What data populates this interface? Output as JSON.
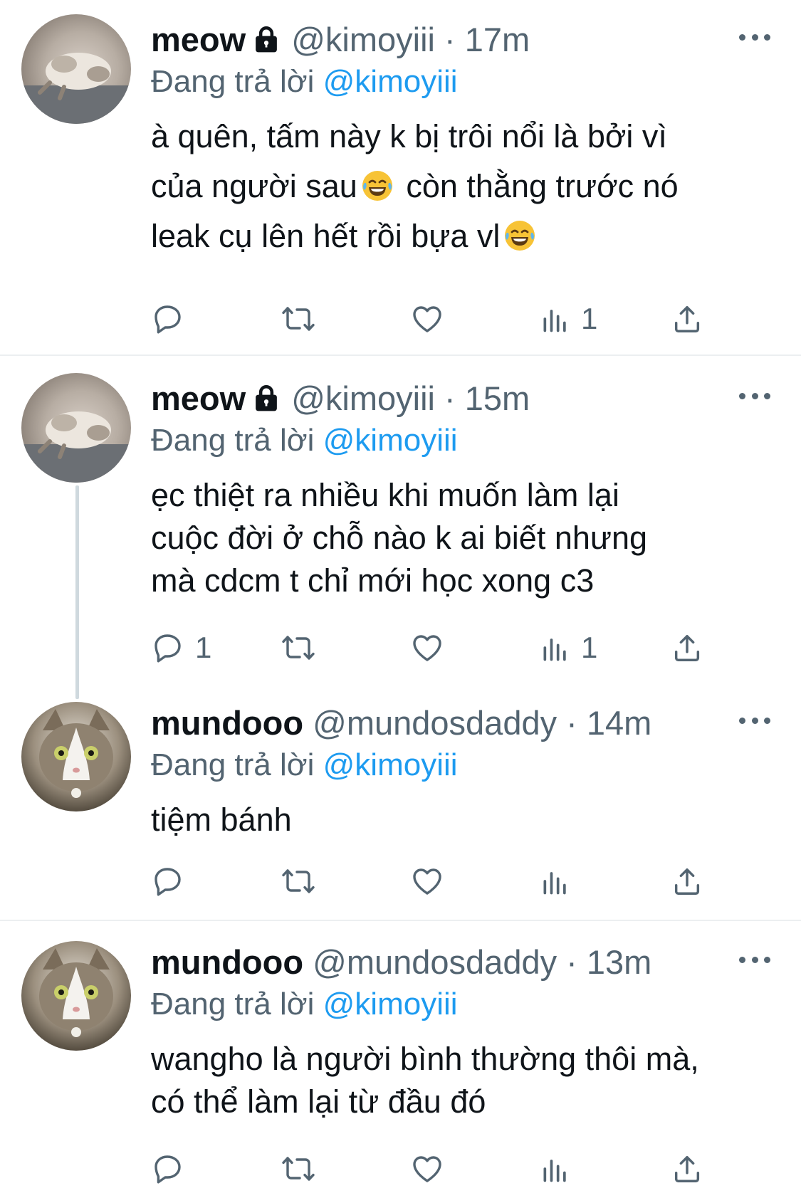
{
  "tweets": [
    {
      "name": "meow",
      "handle": "@kimoyiii",
      "separator": "·",
      "time": "17m",
      "replying_prefix": "Đang trả lời",
      "replying_to": "@kimoyiii",
      "lines": [
        "à quên, tấm này k bị trôi nổi là bởi vì",
        "của người sau",
        "còn thằng trước nó",
        "leak cụ lên hết rồi bựa vl"
      ],
      "avatar_icon": "sleeping-cat-avatar",
      "reply_count": "",
      "views_count": "1",
      "locked": true
    },
    {
      "name": "meow",
      "handle": "@kimoyiii",
      "separator": "·",
      "time": "15m",
      "replying_prefix": "Đang trả lời",
      "replying_to": "@kimoyiii",
      "lines": [
        "ẹc thiệt ra nhiều khi muốn làm lại",
        "cuộc đời ở chỗ nào k ai biết nhưng",
        "mà cdcm t chỉ mới học xong c3"
      ],
      "avatar_icon": "sleeping-cat-avatar",
      "reply_count": "1",
      "views_count": "1",
      "locked": true
    },
    {
      "name": "mundooo",
      "handle": "@mundosdaddy",
      "separator": "·",
      "time": "14m",
      "replying_prefix": "Đang trả lời",
      "replying_to": "@kimoyiii",
      "lines": [
        "tiệm bánh"
      ],
      "avatar_icon": "cat-face-avatar",
      "reply_count": "",
      "views_count": "",
      "locked": false
    },
    {
      "name": "mundooo",
      "handle": "@mundosdaddy",
      "separator": "·",
      "time": "13m",
      "replying_prefix": "Đang trả lời",
      "replying_to": "@kimoyiii",
      "lines": [
        "wangho là người bình thường thôi mà,",
        "có thể làm lại từ đầu đó"
      ],
      "avatar_icon": "cat-face-avatar",
      "reply_count": "",
      "views_count": "",
      "locked": false
    }
  ],
  "emoji": [
    "tears-of-joy-emoji",
    "tears-of-joy-emoji"
  ],
  "icons": [
    "lock-icon",
    "more-icon",
    "reply-icon",
    "retweet-icon",
    "like-icon",
    "views-icon",
    "share-icon"
  ],
  "colors": {
    "mention": "#1d9bf0",
    "secondary": "#536471",
    "text": "#0f1419"
  }
}
